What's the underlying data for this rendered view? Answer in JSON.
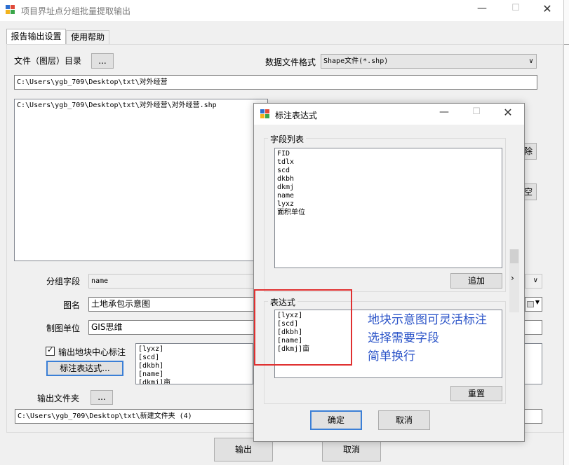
{
  "main_window": {
    "title": "项目界址点分组批量提取输出",
    "tabs": [
      {
        "label": "报告输出设置"
      },
      {
        "label": "使用帮助"
      }
    ],
    "dir_label": "文件（图层）目录",
    "browse_label": "...",
    "format_label": "数据文件格式",
    "format_value": "Shape文件(*.shp)",
    "dir_path": "C:\\Users\\ygb_709\\Desktop\\txt\\对外经营",
    "file_list": [
      "C:\\Users\\ygb_709\\Desktop\\txt\\对外经营\\对外经营.shp"
    ],
    "side_btn_1": "除",
    "side_btn_2": "空",
    "group_field_label": "分组字段",
    "group_field_value": "name",
    "map_name_label": "图名",
    "map_name_value": "土地承包示意图",
    "unit_label": "制图单位",
    "unit_value": "GIS思维",
    "checkbox_label": "输出地块中心标注",
    "checkbox_checked": true,
    "expr_button": "标注表达式...",
    "expr_preview": [
      "[lyxz]",
      "[scd]",
      "[dkbh]",
      "[name]",
      "[dkmj]亩"
    ],
    "output_folder_label": "输出文件夹",
    "output_path": "C:\\Users\\ygb_709\\Desktop\\txt\\新建文件夹 (4)",
    "ok_button": "输出",
    "cancel_button": "取消"
  },
  "dialog": {
    "title": "标注表达式",
    "field_group_label": "字段列表",
    "fields": [
      "FID",
      "tdlx",
      "scd",
      "dkbh",
      "dkmj",
      "name",
      "lyxz",
      "面积单位"
    ],
    "add_button": "追加",
    "expr_group_label": "表达式",
    "expr_lines": [
      "[lyxz]",
      "[scd]",
      "[dkbh]",
      "[name]",
      "[dkmj]亩"
    ],
    "reset_button": "重置",
    "confirm_button": "确定",
    "cancel_button": "取消"
  },
  "annotation": {
    "lines": [
      "地块示意图可灵活标注",
      "选择需要字段",
      "简单换行"
    ],
    "text_color": "#2a53c8",
    "box_color": "#e03030"
  }
}
